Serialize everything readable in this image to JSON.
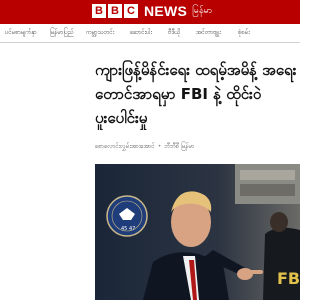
{
  "header": {
    "logo_letters": [
      "B",
      "B",
      "C"
    ],
    "brand_word": "NEWS",
    "language_label": "မြန်မာ",
    "background_color": "#b80000"
  },
  "nav": {
    "items": [
      "ပင်မစာမျက်နှာ",
      "မြန်မာပြည်",
      "ကမ္ဘာ့သတင်း",
      "ဆောင်းပါး",
      "ဗီဒီယို",
      "အင်တာဗျူး",
      "စုံစမ်း"
    ]
  },
  "article": {
    "headline": "ကျားဖြန့်မိန်င်းရေး ထရမ့်အမိန့် အရေးတောင်အာရမှာ FBI နဲ့ ထိုင်းဝဲ ပူးပေါင်းမှု",
    "author": "စောလောင်းလွှမ်းအားအောင်",
    "source": "ဘီဘီစီ မြန်မာ",
    "hero_image_alt": "Donald Trump pointing, FBI agent in background"
  },
  "accent_colors": {
    "brand_red": "#b80000",
    "seal_blue": "#1f3d7a"
  }
}
